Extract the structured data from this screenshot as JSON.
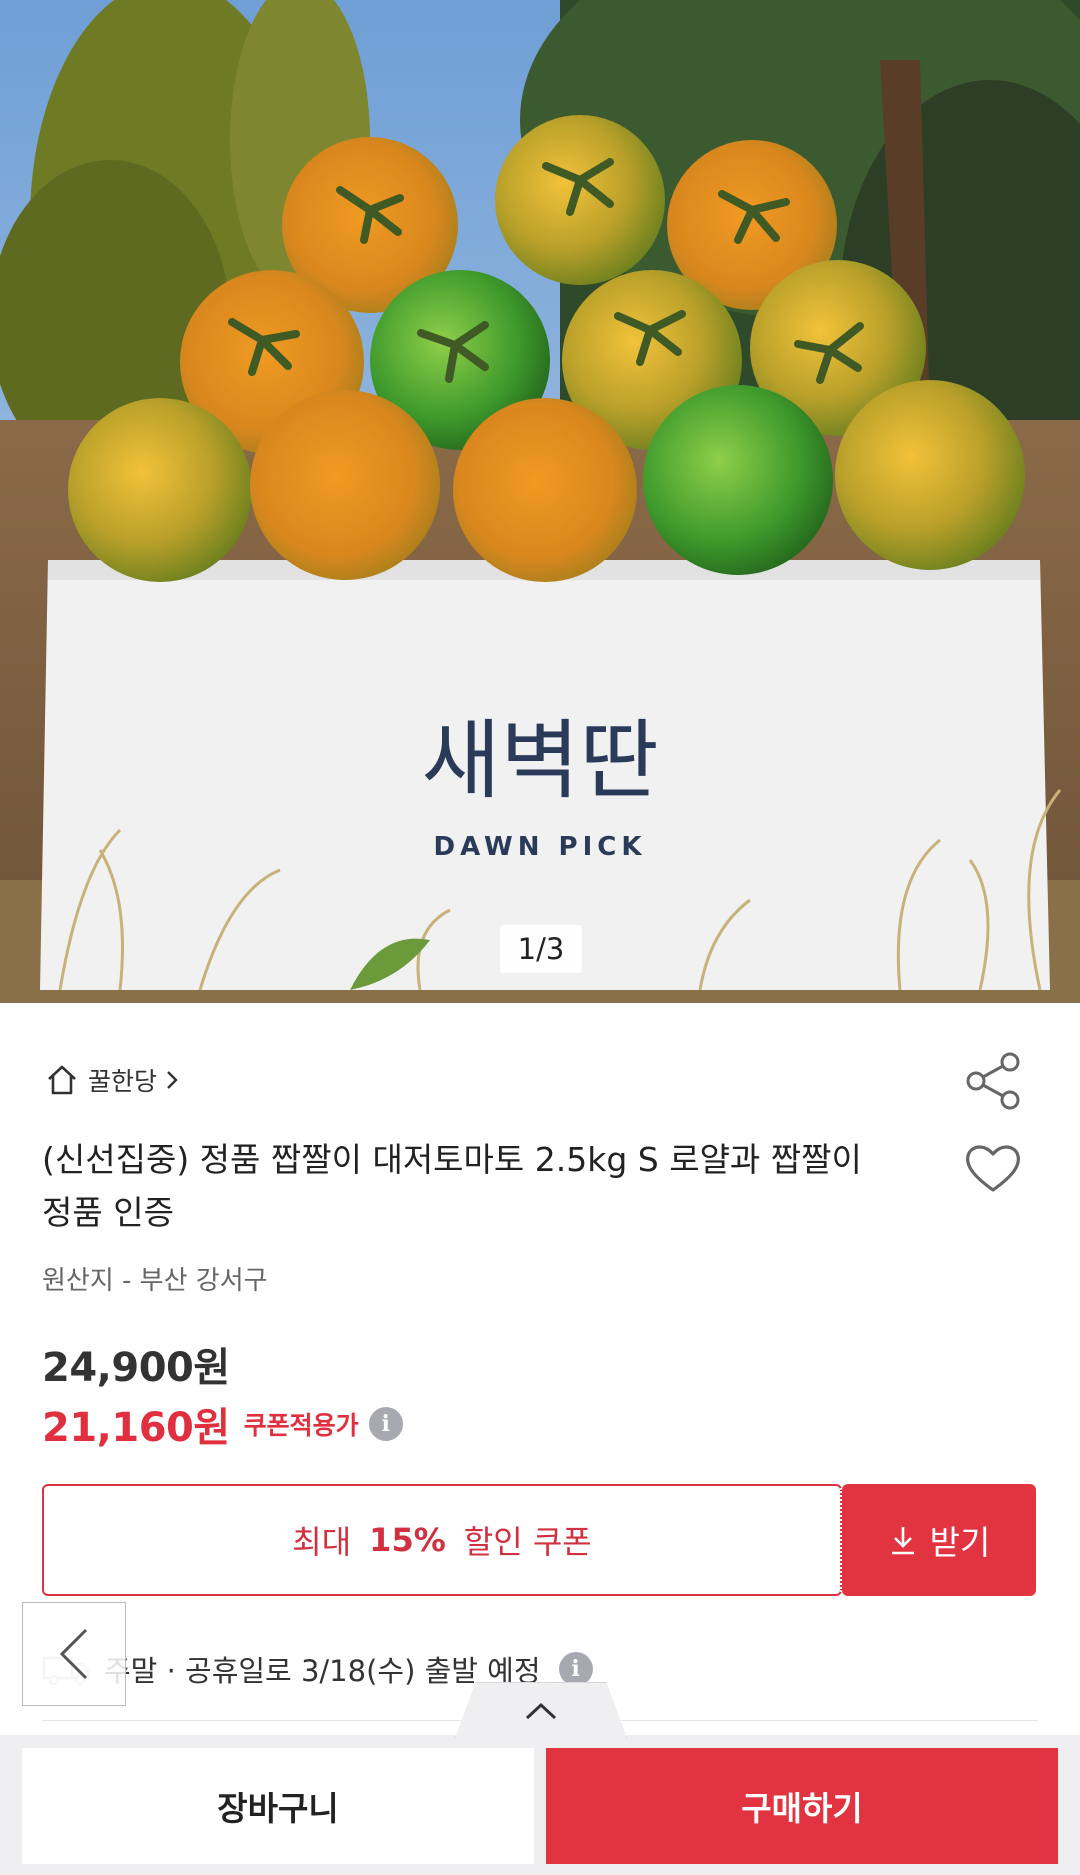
{
  "hero": {
    "counter": "1/3",
    "box_logo_korean": "새벽딴",
    "box_logo_english": "DAWN PICK"
  },
  "store": {
    "name": "꿀한당"
  },
  "product": {
    "title": "(신선집중) 정품 짭짤이 대저토마토 2.5kg S 로얄과 짭짤이 정품 인증",
    "origin": "원산지 - 부산 강서구"
  },
  "price": {
    "original": "24,900원",
    "sale": "21,160원",
    "sale_label": "쿠폰적용가"
  },
  "coupon": {
    "prefix": "최대",
    "percent": "15%",
    "suffix": "할인 쿠폰",
    "button_label": "받기"
  },
  "shipping": {
    "text": "주말 · 공휴일로 3/18(수) 출발 예정"
  },
  "bottom": {
    "cart_label": "장바구니",
    "buy_label": "구매하기"
  },
  "colors": {
    "accent": "#e13340",
    "sale_text": "#e0303f"
  }
}
